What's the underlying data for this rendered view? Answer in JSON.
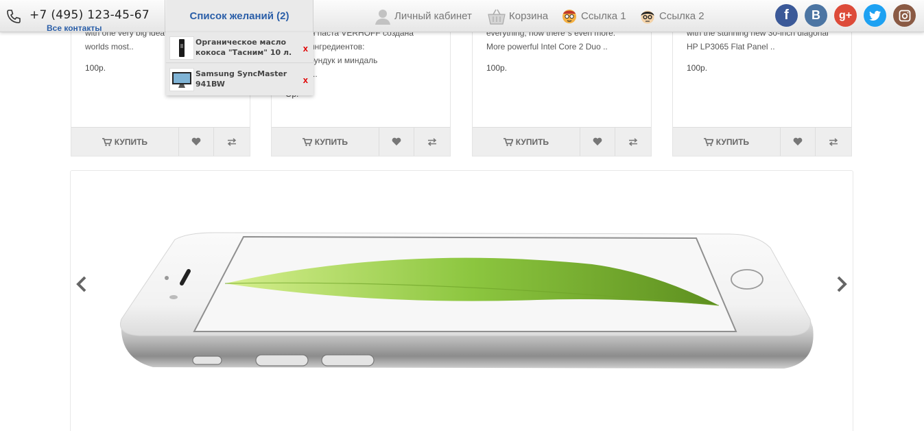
{
  "header": {
    "phone": "+7 (495) 123-45-67",
    "contacts_link": "Все контакты",
    "wishlist_tab": "Список желаний (2)",
    "nav": [
      {
        "label": "Личный кабинет",
        "icon": "user-icon"
      },
      {
        "label": "Корзина",
        "icon": "basket-icon"
      },
      {
        "label": "Ссылка 1",
        "icon": "avatar-nerd-icon"
      },
      {
        "label": "Ссылка 2",
        "icon": "avatar-glasses-icon"
      }
    ],
    "social": [
      {
        "name": "facebook-icon",
        "glyph": "f",
        "color": "#3b5998"
      },
      {
        "name": "vkontakte-icon",
        "glyph": "B",
        "color": "#4c75a3"
      },
      {
        "name": "google-plus-icon",
        "glyph": "g+",
        "color": "#dd4b39"
      },
      {
        "name": "twitter-icon",
        "glyph": "t",
        "color": "#1da1f2"
      },
      {
        "name": "instagram-icon",
        "glyph": "",
        "color": "#8a5a44"
      }
    ]
  },
  "wishlist": {
    "items": [
      {
        "name": "Органическое масло кокоса \"Тасним\" 10 л.",
        "remove": "x"
      },
      {
        "name": "Samsung SyncMaster 941BW",
        "remove": "x"
      }
    ]
  },
  "products": [
    {
      "desc": "with one very big idea\nworlds most..",
      "price": "100р.",
      "buy": "КУПИТЬ"
    },
    {
      "desc": "...адная паста VERHOFF создана\n...щих ингредиентов:\nнные фундук и миндаль\nобжарк..",
      "price": "Ор.",
      "buy": "КУПИТЬ"
    },
    {
      "desc": "everything, now there`s even more.\nMore powerful Intel Core 2 Duo ..",
      "price": "100р.",
      "buy": "КУПИТЬ"
    },
    {
      "desc": "with the stunning new 30-inch diagonal\nHP LP3065 Flat Panel ..",
      "price": "100р.",
      "buy": "КУПИТЬ"
    }
  ],
  "colors": {
    "link": "#2a5ea8",
    "remove": "#e00000",
    "leaf": "#8cc63f"
  }
}
